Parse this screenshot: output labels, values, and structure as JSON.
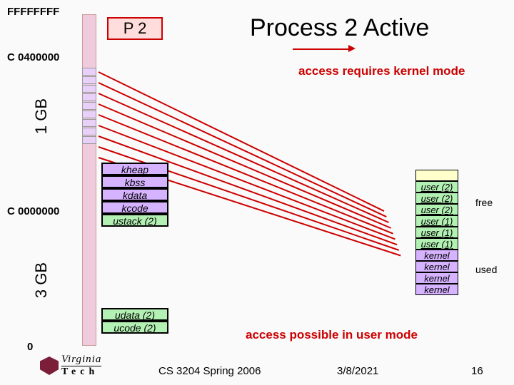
{
  "addresses": {
    "top": "FFFFFFFF",
    "upper": "C 0400000",
    "mid": "C 0000000",
    "bottom": "0"
  },
  "axis": {
    "one_gb": "1 GB",
    "three_gb": "3 GB"
  },
  "p2_label": "P 2",
  "title": "Process 2 Active",
  "notes": {
    "kernel_mode": "access requires kernel mode",
    "user_mode": "access possible in user mode"
  },
  "kernel_segments": [
    "kheap",
    "kbss",
    "kdata",
    "kcode",
    "ustack (2)"
  ],
  "user_segments": [
    "udata (2)",
    "ucode (2)"
  ],
  "phys_pages": [
    {
      "label": "",
      "cls": "free"
    },
    {
      "label": "user (2)",
      "cls": "user"
    },
    {
      "label": "user (2)",
      "cls": "user"
    },
    {
      "label": "user (2)",
      "cls": "user"
    },
    {
      "label": "user (1)",
      "cls": "user"
    },
    {
      "label": "user (1)",
      "cls": "user"
    },
    {
      "label": "user (1)",
      "cls": "user"
    },
    {
      "label": "kernel",
      "cls": "kernel"
    },
    {
      "label": "kernel",
      "cls": "kernel"
    },
    {
      "label": "kernel",
      "cls": "kernel"
    },
    {
      "label": "kernel",
      "cls": "kernel"
    }
  ],
  "phys_annot": {
    "free": "free",
    "used": "used"
  },
  "footer": {
    "course": "CS 3204 Spring 2006",
    "date": "3/8/2021",
    "page": "16"
  },
  "logo": {
    "name": "Virginia Tech"
  }
}
